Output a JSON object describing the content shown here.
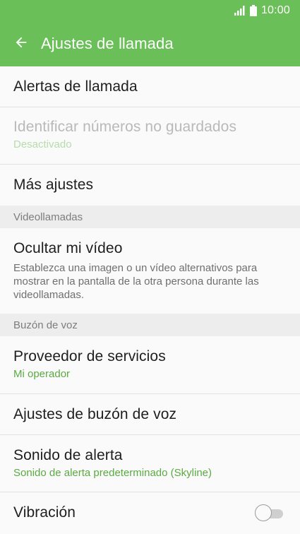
{
  "status_bar": {
    "time": "10:00",
    "icons": [
      "signal-icon",
      "battery-icon"
    ]
  },
  "app_bar": {
    "back_icon": "arrow-left-icon",
    "title": "Ajustes de llamada"
  },
  "items": [
    {
      "title": "Alertas de llamada"
    },
    {
      "title": "Identificar números no guardados",
      "subtitle": "Desactivado",
      "disabled": true
    },
    {
      "title": "Más ajustes"
    }
  ],
  "sections": {
    "video": {
      "header": "Videollamadas",
      "items": [
        {
          "title": "Ocultar mi vídeo",
          "description": "Establezca una imagen o un vídeo alternativos para mostrar en la pantalla de la otra persona durante las videollamadas."
        }
      ]
    },
    "voicemail": {
      "header": "Buzón de voz",
      "items": [
        {
          "title": "Proveedor de servicios",
          "subtitle": "Mi operador"
        },
        {
          "title": "Ajustes de buzón de voz"
        },
        {
          "title": "Sonido de alerta",
          "subtitle": "Sonido de alerta predeterminado (Skyline)"
        },
        {
          "title": "Vibración",
          "toggle": false
        }
      ]
    }
  },
  "colors": {
    "accent": "#6abf58",
    "subtitle_green": "#5aaa42",
    "disabled_text": "#b9b9b9",
    "section_bg": "#ededed"
  }
}
